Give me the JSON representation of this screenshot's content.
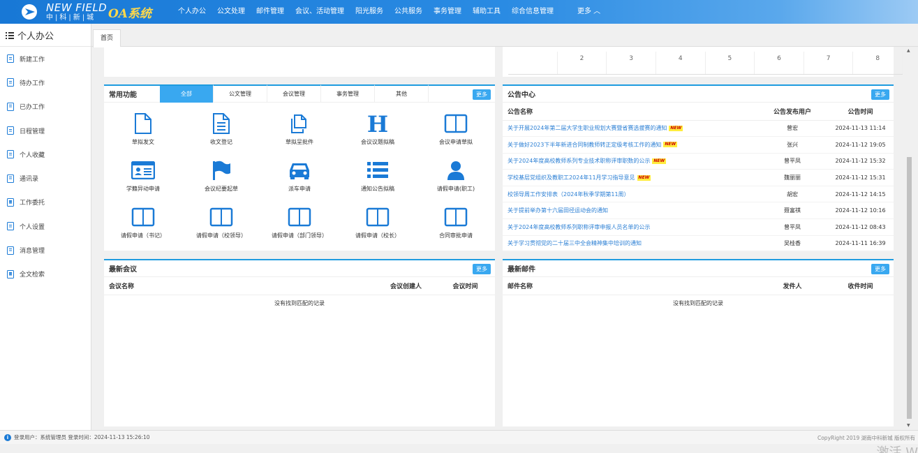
{
  "header": {
    "logo_en": "NEW FIELD",
    "logo_cn": "中|科|新|城",
    "app_title": "OA系统",
    "nav": [
      "个人办公",
      "公文处理",
      "邮件管理",
      "会议、活动管理",
      "阳光服务",
      "公共服务",
      "事务管理",
      "辅助工具",
      "综合信息管理"
    ],
    "more": "更多 ︿"
  },
  "sidebar": {
    "title": "个人办公",
    "items": [
      "新建工作",
      "待办工作",
      "已办工作",
      "日程管理",
      "个人收藏",
      "通讯录",
      "工作委托",
      "个人设置",
      "消息管理",
      "全文检索"
    ]
  },
  "tabs": {
    "home": "首页"
  },
  "calendar": {
    "days": [
      "",
      "2",
      "3",
      "4",
      "5",
      "6",
      "7",
      "8"
    ]
  },
  "common_functions": {
    "title": "常用功能",
    "tabs": [
      "全部",
      "公文管理",
      "会议管理",
      "事务管理",
      "其他"
    ],
    "more": "更多",
    "items": [
      {
        "label": "草拟发文",
        "icon": "document-icon"
      },
      {
        "label": "收文登记",
        "icon": "document-lines-icon"
      },
      {
        "label": "草拟呈批件",
        "icon": "copy-icon"
      },
      {
        "label": "会议议题拟稿",
        "icon": "h-icon"
      },
      {
        "label": "会议申请草拟",
        "icon": "columns-icon"
      },
      {
        "label": "学籍异动申请",
        "icon": "id-card-icon"
      },
      {
        "label": "会议纪要起草",
        "icon": "flag-icon"
      },
      {
        "label": "派车申请",
        "icon": "car-icon"
      },
      {
        "label": "通知公告拟稿",
        "icon": "list-icon"
      },
      {
        "label": "请假申请(职工)",
        "icon": "user-icon"
      },
      {
        "label": "请假申请（书记）",
        "icon": "columns-icon"
      },
      {
        "label": "请假申请（校领导）",
        "icon": "columns-icon"
      },
      {
        "label": "请假申请（部门领导）",
        "icon": "columns-icon"
      },
      {
        "label": "请假申请（校长）",
        "icon": "columns-icon"
      },
      {
        "label": "合同审批申请",
        "icon": "columns-icon"
      }
    ]
  },
  "announcements": {
    "title": "公告中心",
    "more": "更多",
    "columns": [
      "公告名称",
      "公告发布用户",
      "公告时间"
    ],
    "new_label": "NEW",
    "rows": [
      {
        "name": "关于开展2024年第二届大学生职业规划大赛暨省赛选拔赛的通知",
        "user": "曾宏",
        "time": "2024-11-13 11:14",
        "is_new": true
      },
      {
        "name": "关于做好2023下半年新进合同制教师转正定级考核工作的通知",
        "user": "张兴",
        "time": "2024-11-12 19:05",
        "is_new": true
      },
      {
        "name": "关于2024年度高校教师系列专业技术职称评审职数的公示",
        "user": "曾平凤",
        "time": "2024-11-12 15:32",
        "is_new": true
      },
      {
        "name": "学校基层党组织及教职工2024年11月学习指导意见",
        "user": "魏丽丽",
        "time": "2024-11-12 15:31",
        "is_new": true
      },
      {
        "name": "校领导周工作安排表（2024年秋季学期第11周）",
        "user": "胡宏",
        "time": "2024-11-12 14:15",
        "is_new": false
      },
      {
        "name": "关于提前举办第十六届田径运动会的通知",
        "user": "聂富祺",
        "time": "2024-11-12 10:16",
        "is_new": false
      },
      {
        "name": "关于2024年度高校教师系列职称评审申报人员名单的公示",
        "user": "曾平凤",
        "time": "2024-11-12 08:43",
        "is_new": false
      },
      {
        "name": "关于学习贯彻党的二十届三中全会精神集中培训的通知",
        "user": "吴桂香",
        "time": "2024-11-11 16:39",
        "is_new": false
      }
    ]
  },
  "meetings": {
    "title": "最新会议",
    "more": "更多",
    "columns": [
      "会议名称",
      "会议创建人",
      "会议时间"
    ],
    "empty": "没有找到匹配的记录"
  },
  "mails": {
    "title": "最新邮件",
    "more": "更多",
    "columns": [
      "邮件名称",
      "发件人",
      "收件时间"
    ],
    "empty": "没有找到匹配的记录"
  },
  "status": {
    "info": "登录用户：系统管理员  登录时间：2024-11-13 15:26:10",
    "copyright": "CopyRight 2019  湖南中科新城 版权所有",
    "watermark": "激活 W"
  }
}
